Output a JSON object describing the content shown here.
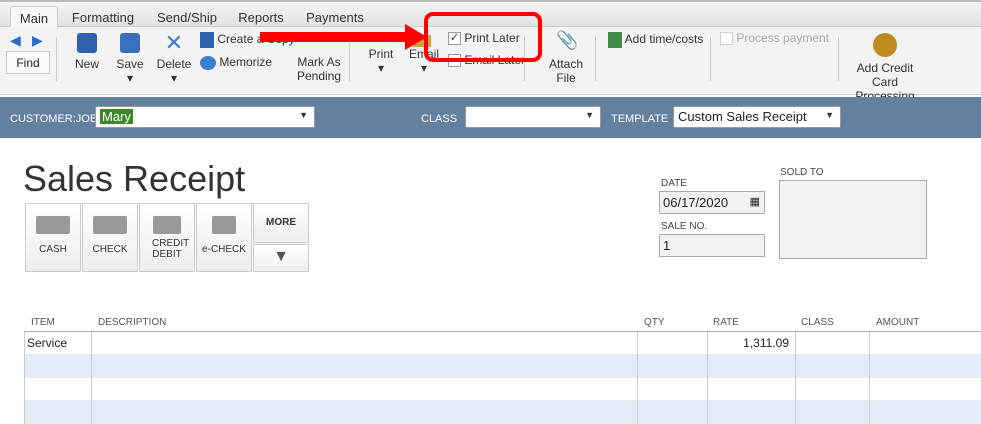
{
  "tabs": [
    "Main",
    "Formatting",
    "Send/Ship",
    "Reports",
    "Payments"
  ],
  "toolbar": {
    "find": "Find",
    "new": "New",
    "save": "Save",
    "delete": "Delete",
    "create_copy": "Create a Copy",
    "memorize": "Memorize",
    "mark_pending": "Mark As Pending",
    "print": "Print",
    "email": "Email",
    "print_later": "Print Later",
    "print_later_checked": true,
    "email_later": "Email Later",
    "attach_file": "Attach File",
    "add_time_costs": "Add time/costs",
    "process_payment": "Process payment",
    "add_cc": "Add Credit Card Processing"
  },
  "bar": {
    "customer_label": "CUSTOMER:JOB",
    "customer_value": "Mary",
    "class_label": "CLASS",
    "class_value": "",
    "template_label": "TEMPLATE",
    "template_value": "Custom Sales Receipt"
  },
  "form": {
    "title": "Sales Receipt",
    "date_label": "DATE",
    "date": "06/17/2020",
    "sale_no_label": "SALE NO.",
    "sale_no": "1",
    "sold_to_label": "SOLD TO"
  },
  "payment_methods": [
    "CASH",
    "CHECK",
    "CREDIT DEBIT",
    "e-CHECK",
    "MORE"
  ],
  "columns": [
    "ITEM",
    "DESCRIPTION",
    "QTY",
    "RATE",
    "CLASS",
    "AMOUNT"
  ],
  "rows": [
    {
      "item": "Service",
      "description": "",
      "qty": "",
      "rate": "1,311.09",
      "class": "",
      "amount": ""
    }
  ],
  "colors": {
    "bar": "#64809f",
    "highlight": "#ff0000"
  }
}
